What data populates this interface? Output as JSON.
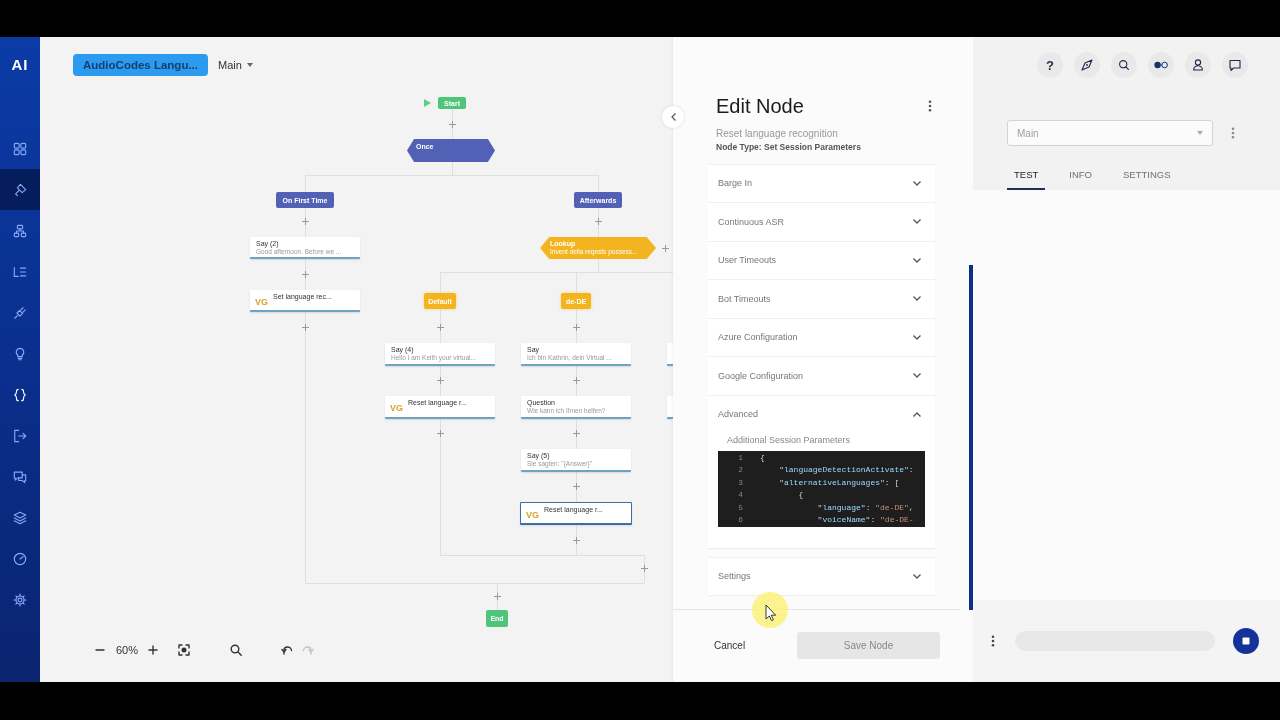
{
  "sidebar": {
    "logo": "AI",
    "items": [
      {
        "kind": "grid",
        "selected": false
      },
      {
        "kind": "brush",
        "selected": true
      },
      {
        "kind": "hierarchy",
        "selected": false
      },
      {
        "kind": "list",
        "selected": false
      },
      {
        "kind": "plug",
        "selected": false
      },
      {
        "kind": "bulb",
        "selected": false
      },
      {
        "kind": "braces",
        "selected": false
      },
      {
        "kind": "exit",
        "selected": false
      },
      {
        "kind": "chat",
        "selected": false
      },
      {
        "kind": "layers",
        "selected": false
      },
      {
        "kind": "gauge",
        "selected": false
      },
      {
        "kind": "gear",
        "selected": false
      }
    ]
  },
  "canvas": {
    "project_button": "AudioCodes Langu...",
    "flow_menu": "Main",
    "nodes": [
      {
        "kind": "start",
        "title": "Start",
        "selected": false
      },
      {
        "kind": "decision",
        "title": "Once",
        "selected": false
      },
      {
        "kind": "branch",
        "title": "On First Time",
        "selected": false
      },
      {
        "kind": "branch",
        "title": "Afterwards",
        "selected": false
      },
      {
        "kind": "say",
        "title": "Say (2)",
        "subtitle": "Good afternoon. Before we ...",
        "selected": false
      },
      {
        "kind": "vg",
        "badge": "VG",
        "title": "Set language rec...",
        "selected": false
      },
      {
        "kind": "lookup",
        "title": "Lookup",
        "subtitle": "Invent della reqests possess...",
        "selected": false
      },
      {
        "kind": "case",
        "title": "Default",
        "selected": false
      },
      {
        "kind": "case",
        "title": "de-DE",
        "selected": false
      },
      {
        "kind": "say",
        "title": "Say (4)",
        "subtitle": "Hello I am Keith your virtual...",
        "selected": false
      },
      {
        "kind": "say",
        "title": "Say",
        "subtitle": "Ich bin Kathrin, dein Virtual ...",
        "selected": false
      },
      {
        "kind": "vg",
        "badge": "VG",
        "title": "Reset language r...",
        "selected": false
      },
      {
        "kind": "say",
        "title": "Question",
        "subtitle": "Wie kann ich Ihnen helfen?",
        "selected": false
      },
      {
        "kind": "say",
        "title": "Say (5)",
        "subtitle": "Sie sagten: \"{Answer}\"",
        "selected": false
      },
      {
        "kind": "vg",
        "badge": "VG",
        "title": "Reset language r...",
        "selected": true
      },
      {
        "kind": "end",
        "title": "End",
        "selected": false
      },
      {
        "kind": "say",
        "selected": false
      },
      {
        "kind": "vg",
        "selected": false
      }
    ],
    "zoom_bar": {
      "level_text": "60%",
      "undo": {
        "disabled": false
      },
      "redo": {
        "disabled": true
      }
    }
  },
  "edit_node": {
    "title": "Edit Node",
    "node_name": "Reset language recognition",
    "node_type": "Node Type: Set Session Parameters",
    "sections": [
      {
        "label": "Barge In",
        "expanded": false
      },
      {
        "label": "Continuous ASR",
        "expanded": false
      },
      {
        "label": "User Timeouts",
        "expanded": false
      },
      {
        "label": "Bot Timeouts",
        "expanded": false
      },
      {
        "label": "Azure Configuration",
        "expanded": false
      },
      {
        "label": "Google Configuration",
        "expanded": false
      },
      {
        "label": "Advanced",
        "expanded": true,
        "field_label": "Additional Session Parameters",
        "code": [
          {
            "number": "1",
            "tokens": [
              {
                "kind": "punct",
                "text": "{"
              }
            ]
          },
          {
            "number": "2",
            "tokens": [
              {
                "kind": "key",
                "text": "    \"languageDetectionActivate\""
              },
              {
                "kind": "punct",
                "text": ":"
              }
            ]
          },
          {
            "number": "3",
            "tokens": [
              {
                "kind": "key",
                "text": "    \"alternativeLanguages\""
              },
              {
                "kind": "punct",
                "text": ": ["
              }
            ]
          },
          {
            "number": "4",
            "tokens": [
              {
                "kind": "punct",
                "text": "        {"
              }
            ]
          },
          {
            "number": "5",
            "tokens": [
              {
                "kind": "key",
                "text": "            \"language\""
              },
              {
                "kind": "punct",
                "text": ": "
              },
              {
                "kind": "string",
                "text": "\"de-DE\""
              },
              {
                "kind": "punct",
                "text": ","
              }
            ]
          },
          {
            "number": "6",
            "tokens": [
              {
                "kind": "key",
                "text": "            \"voiceName\""
              },
              {
                "kind": "punct",
                "text": ": "
              },
              {
                "kind": "string",
                "text": "\"de-DE-"
              }
            ]
          }
        ]
      },
      {
        "label": "Settings",
        "expanded": false
      }
    ],
    "cancel": "Cancel",
    "save": {
      "label": "Save Node",
      "disabled": true
    }
  },
  "test_panel": {
    "help": "?",
    "icons": [
      {
        "kind": "compass"
      },
      {
        "kind": "search"
      },
      {
        "kind": "toggle"
      },
      {
        "kind": "user"
      },
      {
        "kind": "chat"
      }
    ],
    "bot_selector": {
      "placeholder": "Main"
    },
    "tabs": [
      {
        "label": "TEST",
        "selected": true
      },
      {
        "label": "INFO",
        "selected": false
      },
      {
        "label": "SETTINGS",
        "selected": false
      }
    ]
  }
}
